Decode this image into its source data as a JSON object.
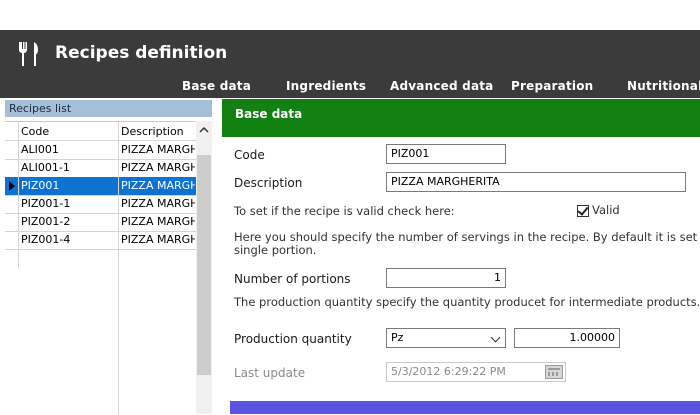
{
  "header": {
    "title": "Recipes definition",
    "tabs": [
      "Base data",
      "Ingredients",
      "Advanced data",
      "Preparation",
      "Nutritional"
    ]
  },
  "recipes_list": {
    "title": "Recipes list",
    "columns": [
      "Code",
      "Description"
    ],
    "rows": [
      {
        "code": "ALI001",
        "description": "PIZZA MARGHERITA"
      },
      {
        "code": "ALI001-1",
        "description": "PIZZA MARGHERITA"
      },
      {
        "code": "PIZ001",
        "description": "PIZZA MARGHERITA"
      },
      {
        "code": "PIZ001-1",
        "description": "PIZZA MARGHERITA"
      },
      {
        "code": "PIZ001-2",
        "description": "PIZZA MARGHERITA"
      },
      {
        "code": "PIZ001-4",
        "description": "PIZZA MARGHERITA"
      }
    ],
    "selected_index": 2
  },
  "base_data": {
    "section_title": "Base data",
    "code_label": "Code",
    "code_value": "PIZ001",
    "description_label": "Description",
    "description_value": "PIZZA MARGHERITA",
    "valid_hint": "To set if the recipe is valid check here:",
    "valid_label": "Valid",
    "valid_checked": true,
    "servings_hint_1": "Here you should specify the number of servings in the recipe. By default it is set to",
    "servings_hint_2": "single portion.",
    "portions_label": "Number of portions",
    "portions_value": "1",
    "production_hint": "The production quantity specify the quantity producet for intermediate products.",
    "production_label": "Production quantity",
    "unit_value": "Pz",
    "production_value": "1.00000",
    "last_update_label": "Last update",
    "last_update_value": "5/3/2012 6:29:22 PM"
  },
  "colors": {
    "header_bg": "#3b3b3b",
    "section_bar": "#128012",
    "selection": "#0f72d0",
    "list_title_bg": "#a6bfd9",
    "bottom_bar": "#5a52e0"
  },
  "icons": {
    "app": "fork-knife-icon",
    "calendar": "calendar-icon",
    "dropdown": "chevron-down-icon",
    "scroll_up": "chevron-up-icon",
    "row_pointer": "row-pointer-icon",
    "check": "check-icon"
  }
}
